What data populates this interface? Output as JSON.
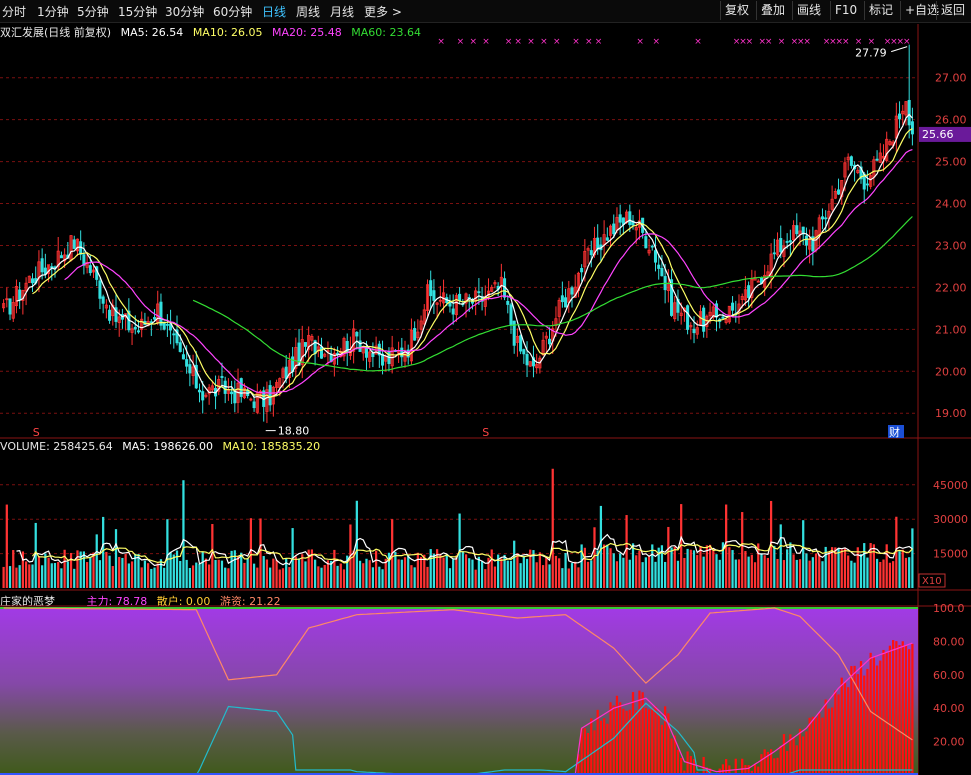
{
  "toolbar": {
    "periods": [
      "分时",
      "1分钟",
      "5分钟",
      "15分钟",
      "30分钟",
      "60分钟",
      "日线",
      "周线",
      "月线",
      "更多 >"
    ],
    "active_period": "日线",
    "right_buttons": [
      "复权",
      "叠加",
      "画线",
      "F10",
      "标记",
      "+自选",
      "返回"
    ]
  },
  "price_legend": {
    "title": "双汇发展(日线 前复权)",
    "ma5": "MA5: 26.54",
    "ma10": "MA10: 26.05",
    "ma20": "MA20: 25.48",
    "ma60": "MA60: 23.64"
  },
  "volume_legend": {
    "vol": "VOLUME: 258425.64",
    "ma5": "MA5: 198626.00",
    "ma10": "MA10: 185835.20"
  },
  "indicator_legend": {
    "title": "庄家的恶梦",
    "main": "主力: 78.78",
    "retail": "散户: 0.00",
    "hot": "游资: 21.22"
  },
  "markers": {
    "high_label": "27.79",
    "low_label": "18.80",
    "current_price": "25.66",
    "s_mark": "S",
    "cai_mark": "财",
    "x10": "X10",
    "x_mark": "×"
  },
  "colors": {
    "up": "#ff3333",
    "down": "#33e0e0",
    "ma5": "#ffffff",
    "ma10": "#ffff66",
    "ma20": "#ff44ff",
    "ma60": "#33dd33",
    "retail_line": "#ff8866",
    "main_line": "#ff33cc",
    "hot_line": "#22bbcc",
    "current_price_bg": "#6a1a9a"
  },
  "chart_data": [
    {
      "type": "candlestick",
      "name": "price",
      "ylim": [
        18.6,
        27.9
      ],
      "yticks": [
        "19.00",
        "20.00",
        "21.00",
        "22.00",
        "23.00",
        "24.00",
        "25.00",
        "26.00",
        "27.00"
      ],
      "high": 27.79,
      "low": 18.8,
      "last": 25.66,
      "anchors_close": [
        [
          0,
          21.4
        ],
        [
          8,
          22.2
        ],
        [
          15,
          22.6
        ],
        [
          22,
          23.1
        ],
        [
          28,
          22.3
        ],
        [
          34,
          21.3
        ],
        [
          42,
          21.0
        ],
        [
          48,
          21.5
        ],
        [
          55,
          20.3
        ],
        [
          62,
          19.5
        ],
        [
          68,
          19.6
        ],
        [
          76,
          19.4
        ],
        [
          82,
          19.3
        ],
        [
          88,
          20.0
        ],
        [
          95,
          20.7
        ],
        [
          102,
          20.5
        ],
        [
          110,
          20.8
        ],
        [
          118,
          20.2
        ],
        [
          126,
          20.6
        ],
        [
          132,
          21.8
        ],
        [
          140,
          21.6
        ],
        [
          148,
          21.7
        ],
        [
          155,
          22.0
        ],
        [
          160,
          20.6
        ],
        [
          165,
          20.0
        ],
        [
          172,
          21.3
        ],
        [
          180,
          22.5
        ],
        [
          188,
          23.3
        ],
        [
          195,
          23.7
        ],
        [
          202,
          23.0
        ],
        [
          208,
          21.6
        ],
        [
          215,
          21.1
        ],
        [
          222,
          21.3
        ],
        [
          230,
          21.6
        ],
        [
          238,
          22.6
        ],
        [
          245,
          23.3
        ],
        [
          252,
          23.1
        ],
        [
          258,
          24.1
        ],
        [
          263,
          25.0
        ],
        [
          268,
          24.6
        ],
        [
          273,
          25.0
        ],
        [
          278,
          25.9
        ],
        [
          281,
          26.6
        ],
        [
          283,
          25.7
        ]
      ]
    },
    {
      "type": "bar",
      "name": "volume",
      "ylim": [
        0,
        58000
      ],
      "yticks": [
        "15000",
        "30000",
        "45000"
      ],
      "last": 258425.64,
      "ma5_last": 198626.0,
      "ma10_last": 185835.2
    },
    {
      "type": "line",
      "name": "庄家的恶梦",
      "ylim": [
        0,
        100
      ],
      "yticks": [
        "20.00",
        "40.00",
        "60.00",
        "80.00",
        "100.0"
      ],
      "series": [
        {
          "name": "主力",
          "last": 78.78,
          "anchors": [
            [
              0,
              0
            ],
            [
              150,
              0
            ],
            [
              178,
              0
            ],
            [
              180,
              28
            ],
            [
              190,
              40
            ],
            [
              200,
              46
            ],
            [
              206,
              35
            ],
            [
              212,
              8
            ],
            [
              222,
              2
            ],
            [
              232,
              4
            ],
            [
              240,
              14
            ],
            [
              250,
              28
            ],
            [
              260,
              52
            ],
            [
              270,
              70
            ],
            [
              283,
              79
            ]
          ]
        },
        {
          "name": "散户",
          "last": 0.0,
          "anchors": [
            [
              0,
              0
            ],
            [
              283,
              0
            ]
          ]
        },
        {
          "name": "游资",
          "last": 21.22,
          "anchors": [
            [
              0,
              100
            ],
            [
              60,
              99
            ],
            [
              70,
              57
            ],
            [
              75,
              58
            ],
            [
              85,
              60
            ],
            [
              95,
              88
            ],
            [
              110,
              96
            ],
            [
              140,
              99
            ],
            [
              160,
              94
            ],
            [
              175,
              96
            ],
            [
              190,
              76
            ],
            [
              200,
              55
            ],
            [
              210,
              72
            ],
            [
              220,
              97
            ],
            [
              240,
              100
            ],
            [
              248,
              95
            ],
            [
              260,
              72
            ],
            [
              270,
              38
            ],
            [
              283,
              21
            ]
          ]
        }
      ]
    }
  ]
}
